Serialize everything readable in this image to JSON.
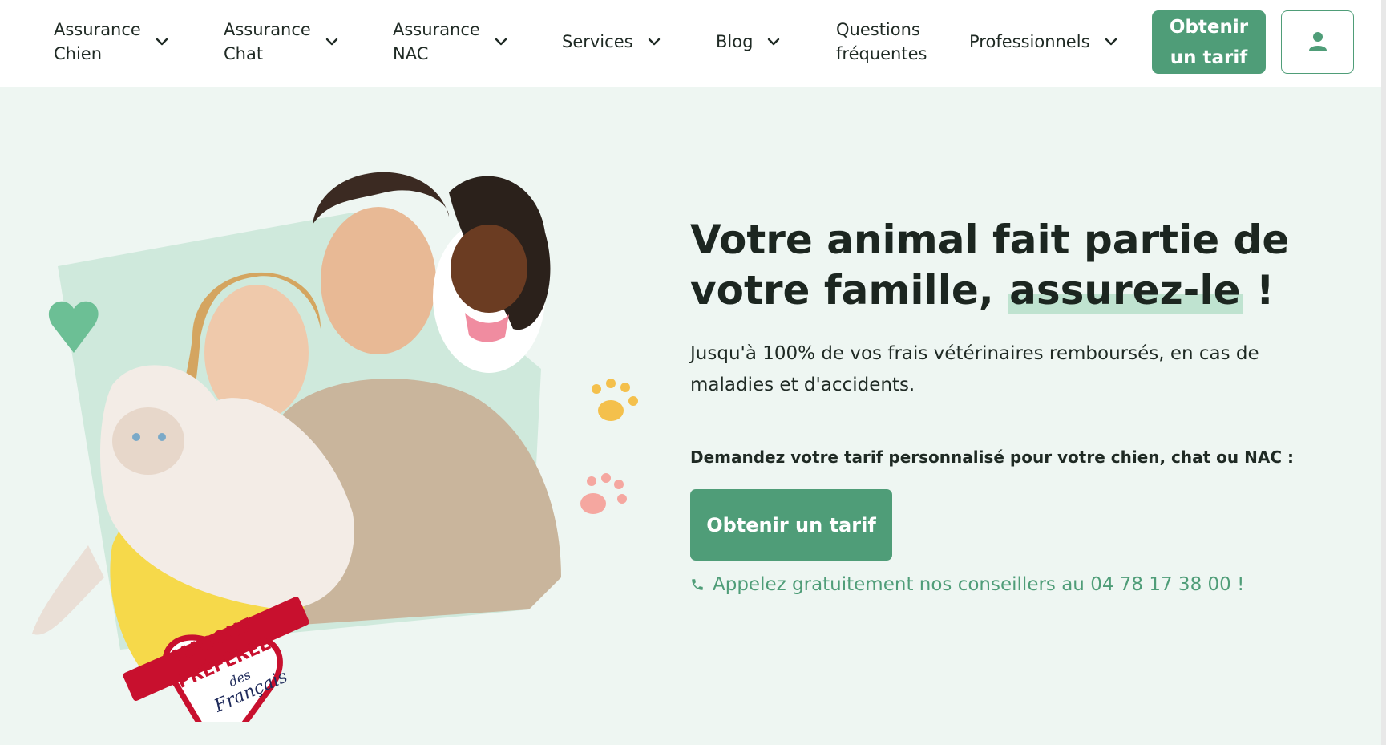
{
  "nav": {
    "items": [
      {
        "line1": "Assurance",
        "line2": "Chien"
      },
      {
        "line1": "Assurance",
        "line2": "Chat"
      },
      {
        "line1": "Assurance",
        "line2": "NAC"
      },
      {
        "line1": "Services",
        "line2": ""
      },
      {
        "line1": "Blog",
        "line2": ""
      },
      {
        "line1": "Questions",
        "line2": "fréquentes"
      },
      {
        "line1": "Professionnels",
        "line2": ""
      }
    ],
    "cta_line1": "Obtenir",
    "cta_line2": "un tarif",
    "account_icon": "user-icon"
  },
  "hero": {
    "headline_part1": "Votre animal fait partie de votre famille, ",
    "headline_highlight": "assurez-le",
    "headline_end": " !",
    "subtitle": "Jusqu'à 100% de vos frais vétérinaires remboursés, en cas de maladies et d'accidents.",
    "ask": "Demandez votre tarif personnalisé pour votre chien, chat ou NAC :",
    "cta_label": "Obtenir un tarif",
    "phone_text": "Appelez gratuitement nos conseillers au 04 78 17 38 00 !",
    "badge_line1": "MARQUE",
    "badge_line2": "PRÉFÉRÉE",
    "badge_line3": "des",
    "badge_line4": "Français"
  },
  "colors": {
    "brand_green": "#4f9d78",
    "background": "#eef6f2",
    "highlight": "#bfe3d0",
    "badge_red": "#c8102e"
  }
}
